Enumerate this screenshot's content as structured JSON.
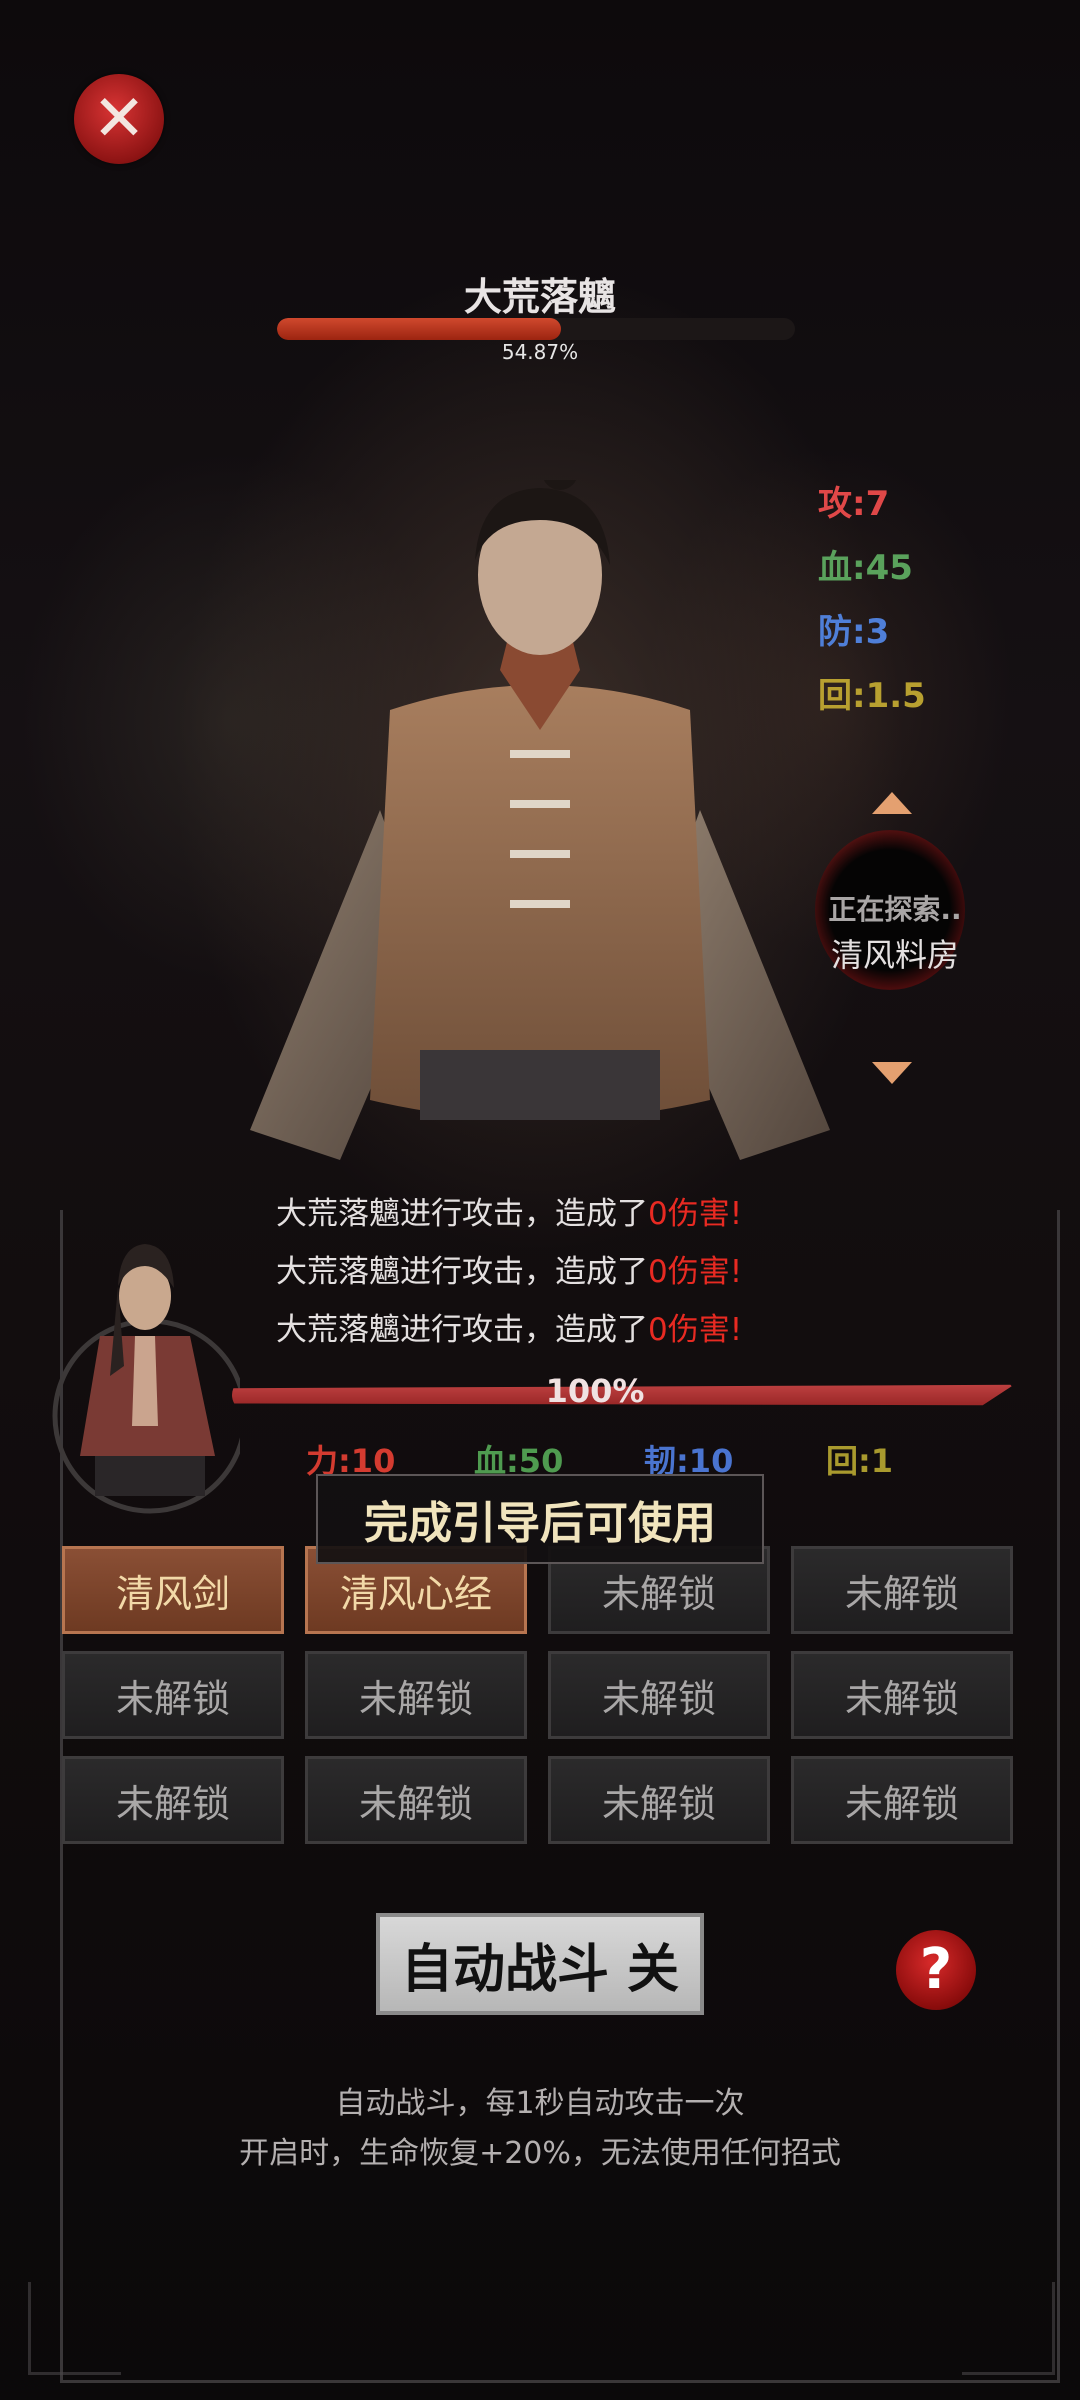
{
  "boss": {
    "name": "大荒落魑",
    "hp_fraction": 0.5487,
    "hp_percent": "54.87%"
  },
  "enemy_stats": {
    "attack": "攻:7",
    "blood": "血:45",
    "defense": "防:3",
    "regen": "回:1.5"
  },
  "explore": {
    "title": "正在探索..",
    "location": "清风料房"
  },
  "combat_log": [
    {
      "text": "大荒落魑进行攻击，造成了",
      "damage": "0伤害!"
    },
    {
      "text": "大荒落魑进行攻击，造成了",
      "damage": "0伤害!"
    },
    {
      "text": "大荒落魑进行攻击，造成了",
      "damage": "0伤害!"
    }
  ],
  "player": {
    "hp_percent": "100%",
    "hp_fraction": 1.0,
    "stats": {
      "power": "力:10",
      "blood": "血:50",
      "toughness": "韧:10",
      "regen": "回:1"
    }
  },
  "tooltip": "完成引导后可使用",
  "skills": [
    {
      "label": "清风剑",
      "active": true
    },
    {
      "label": "清风心经",
      "active": true
    },
    {
      "label": "未解锁",
      "active": false
    },
    {
      "label": "未解锁",
      "active": false
    },
    {
      "label": "未解锁",
      "active": false
    },
    {
      "label": "未解锁",
      "active": false
    },
    {
      "label": "未解锁",
      "active": false
    },
    {
      "label": "未解锁",
      "active": false
    },
    {
      "label": "未解锁",
      "active": false
    },
    {
      "label": "未解锁",
      "active": false
    },
    {
      "label": "未解锁",
      "active": false
    },
    {
      "label": "未解锁",
      "active": false
    }
  ],
  "auto_battle": {
    "label": "自动战斗 关"
  },
  "description": {
    "line1": "自动战斗，每1秒自动攻击一次",
    "line2": "开启时，生命恢复+20%，无法使用任何招式"
  },
  "icons": {
    "close": "close-icon",
    "help": "question-icon",
    "up": "triangle-up-icon",
    "down": "triangle-down-icon"
  },
  "colors": {
    "attack": "#e04848",
    "blood": "#5aa25c",
    "defense": "#4f7fd8",
    "regen": "#b8a030",
    "power": "#d43b30",
    "p_blood": "#4f9b50",
    "toughness": "#4a74d0",
    "p_regen": "#a99a2e",
    "damage": "#e82a22",
    "accent": "#b77550"
  }
}
